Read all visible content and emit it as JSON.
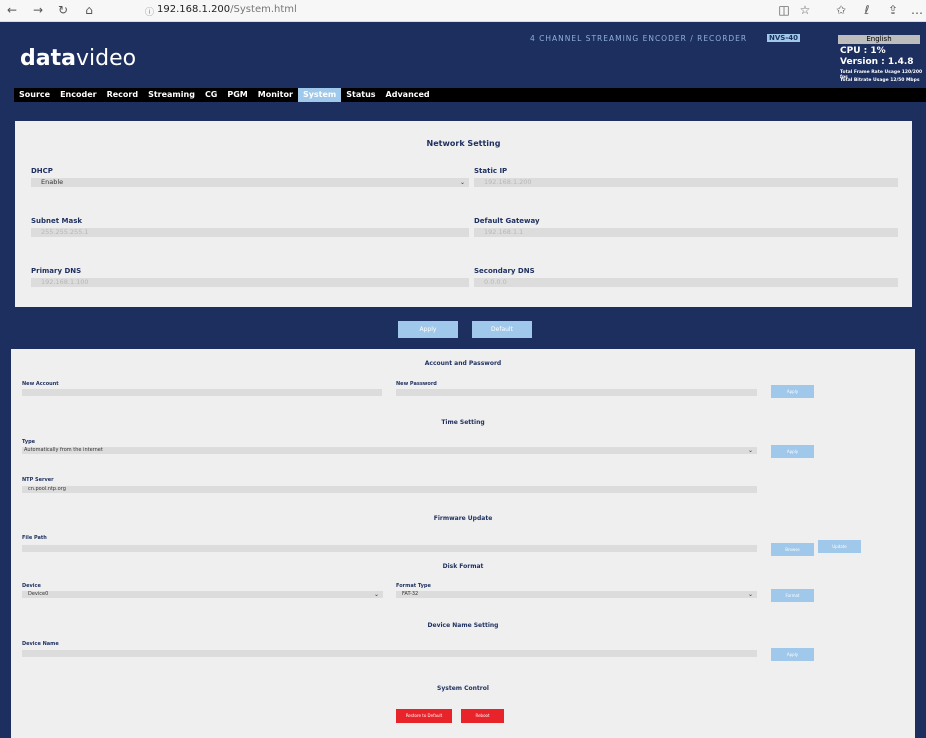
{
  "browser": {
    "url_host": "192.168.1.200",
    "url_path": "/System.html",
    "back": "←",
    "forward": "→",
    "refresh": "↻",
    "home": "⌂",
    "info": "ⓘ",
    "reader": "◫",
    "star": "☆",
    "favorites": "✩",
    "profile": "ℓ",
    "share": "⇪",
    "more": "…"
  },
  "header": {
    "logo_bold": "data",
    "logo_light": "video",
    "subtitle": "4 CHANNEL STREAMING ENCODER / RECORDER",
    "model": "NVS-40",
    "language": "English",
    "cpu": "CPU : 1%",
    "version": "Version : 1.4.8",
    "frame_rate": "Total Frame Rate Usage 120/200 fps",
    "bitrate": "Total Bitrate Usage 12/50 Mbps"
  },
  "menu": [
    "Source",
    "Encoder",
    "Record",
    "Streaming",
    "CG",
    "PGM",
    "Monitor",
    "System",
    "Status",
    "Advanced"
  ],
  "menu_active": "System",
  "network": {
    "title": "Network Setting",
    "dhcp_label": "DHCP",
    "dhcp_value": "Enable",
    "static_ip_label": "Static IP",
    "static_ip": "192.168.1.200",
    "subnet_label": "Subnet Mask",
    "subnet": "255.255.255.1",
    "gateway_label": "Default Gateway",
    "gateway": "192.168.1.1",
    "pdns_label": "Primary DNS",
    "pdns": "192.168.1.100",
    "sdns_label": "Secondary DNS",
    "sdns": "0.0.0.0",
    "apply": "Apply",
    "default": "Default"
  },
  "account": {
    "title": "Account and Password",
    "new_account_label": "New Account",
    "new_password_label": "New Password",
    "apply": "Apply"
  },
  "time": {
    "title": "Time Setting",
    "type_label": "Type",
    "type_value": "Automatically from the internet",
    "apply": "Apply",
    "ntp_label": "NTP Server",
    "ntp_value": "cn.pool.ntp.org"
  },
  "firmware": {
    "title": "Firmware Update",
    "file_label": "File Path",
    "browse": "Browse",
    "update": "Update"
  },
  "disk": {
    "title": "Disk Format",
    "device_label": "Device",
    "device_value": "Device0",
    "format_label": "Format Type",
    "format_value": "FAT-32",
    "format_btn": "Format"
  },
  "devname": {
    "title": "Device Name Setting",
    "label": "Device Name",
    "apply": "Apply"
  },
  "syscontrol": {
    "title": "System Control",
    "restore": "Restore to Default",
    "reboot": "Reboot"
  },
  "colors": {
    "navy": "#1d2f5f",
    "accent": "#9fc8ea",
    "danger": "#e8232a"
  }
}
